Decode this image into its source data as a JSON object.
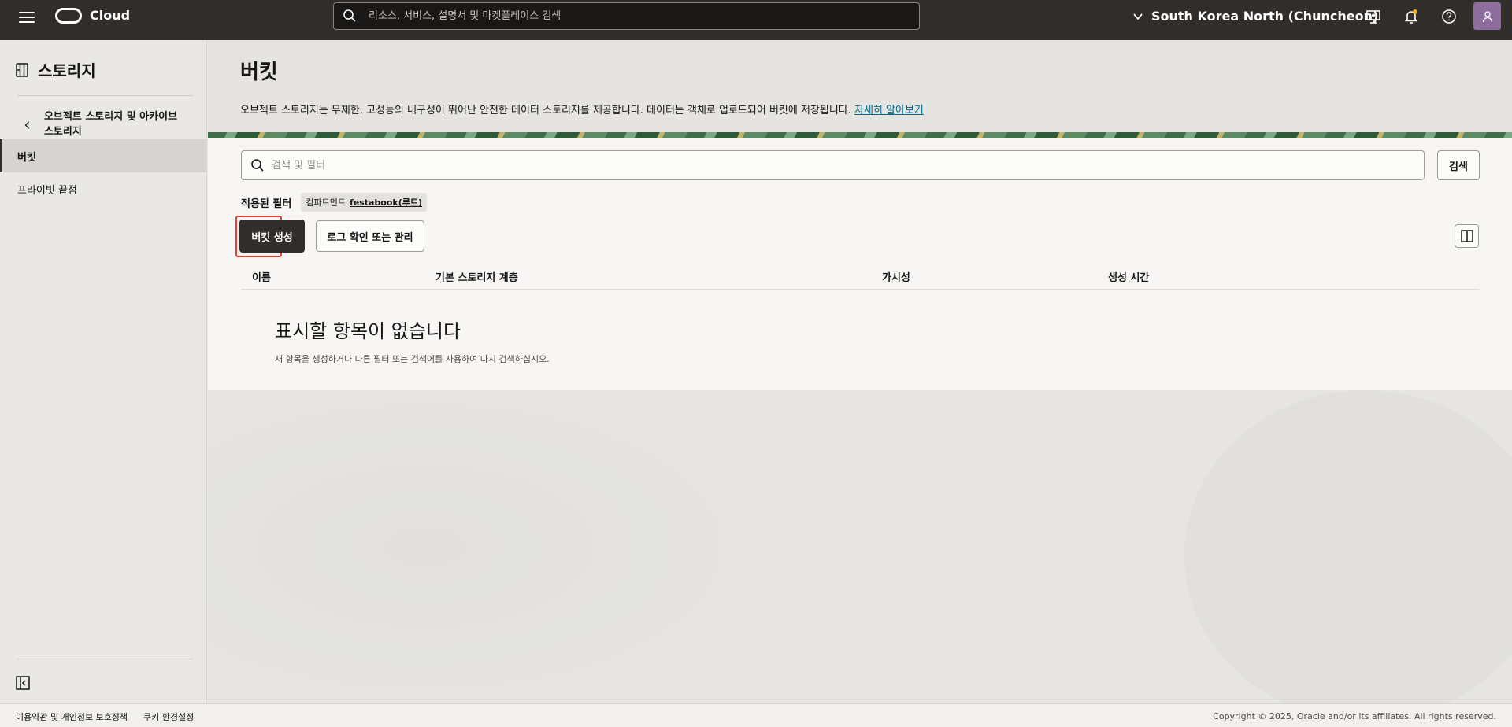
{
  "topbar": {
    "brand": "Cloud",
    "search_placeholder": "리소스, 서비스, 설명서 및 마켓플레이스 검색",
    "region": "South Korea North (Chuncheon)",
    "icons": [
      "hamburger-icon",
      "cloud-logo",
      "search-icon",
      "chevron-down-icon",
      "console-icon",
      "bell-icon",
      "help-icon",
      "user-icon"
    ]
  },
  "sidebar": {
    "title": "스토리지",
    "back_label": "오브젝트 스토리지 및 아카이브 스토리지",
    "items": [
      {
        "label": "버킷",
        "active": true
      },
      {
        "label": "프라이빗 끝점",
        "active": false
      }
    ]
  },
  "main": {
    "title": "버킷",
    "description": "오브젝트 스토리지는 무제한, 고성능의 내구성이 뛰어난 안전한 데이터 스토리지를 제공합니다. 데이터는 객체로 업로드되어 버킷에 저장됩니다.",
    "learn_more": "자세히 알아보기",
    "filter_placeholder": "검색 및 필터",
    "search_button": "검색",
    "applied_filters_label": "적용된 필터",
    "chip_label": "컴파트먼트",
    "chip_value": "festabook(루트)",
    "create_button": "버킷 생성",
    "log_button": "로그 확인 또는 관리",
    "columns": [
      "이름",
      "기본 스토리지 계층",
      "가시성",
      "생성 시간"
    ],
    "empty_title": "표시할 항목이 없습니다",
    "empty_desc": "새 항목을 생성하거나 다른 필터 또는 검색어를 사용하여 다시 검색하십시오."
  },
  "footer": {
    "links": [
      "이용약관 및 개인정보 보호정책",
      "쿠키 환경설정"
    ],
    "copyright": "Copyright © 2025, Oracle and/or its affiliates. All rights reserved."
  },
  "colors": {
    "topbar": "#312d2a",
    "primary_button": "#312d2a",
    "highlight": "#e0412e",
    "link": "#00688c"
  }
}
